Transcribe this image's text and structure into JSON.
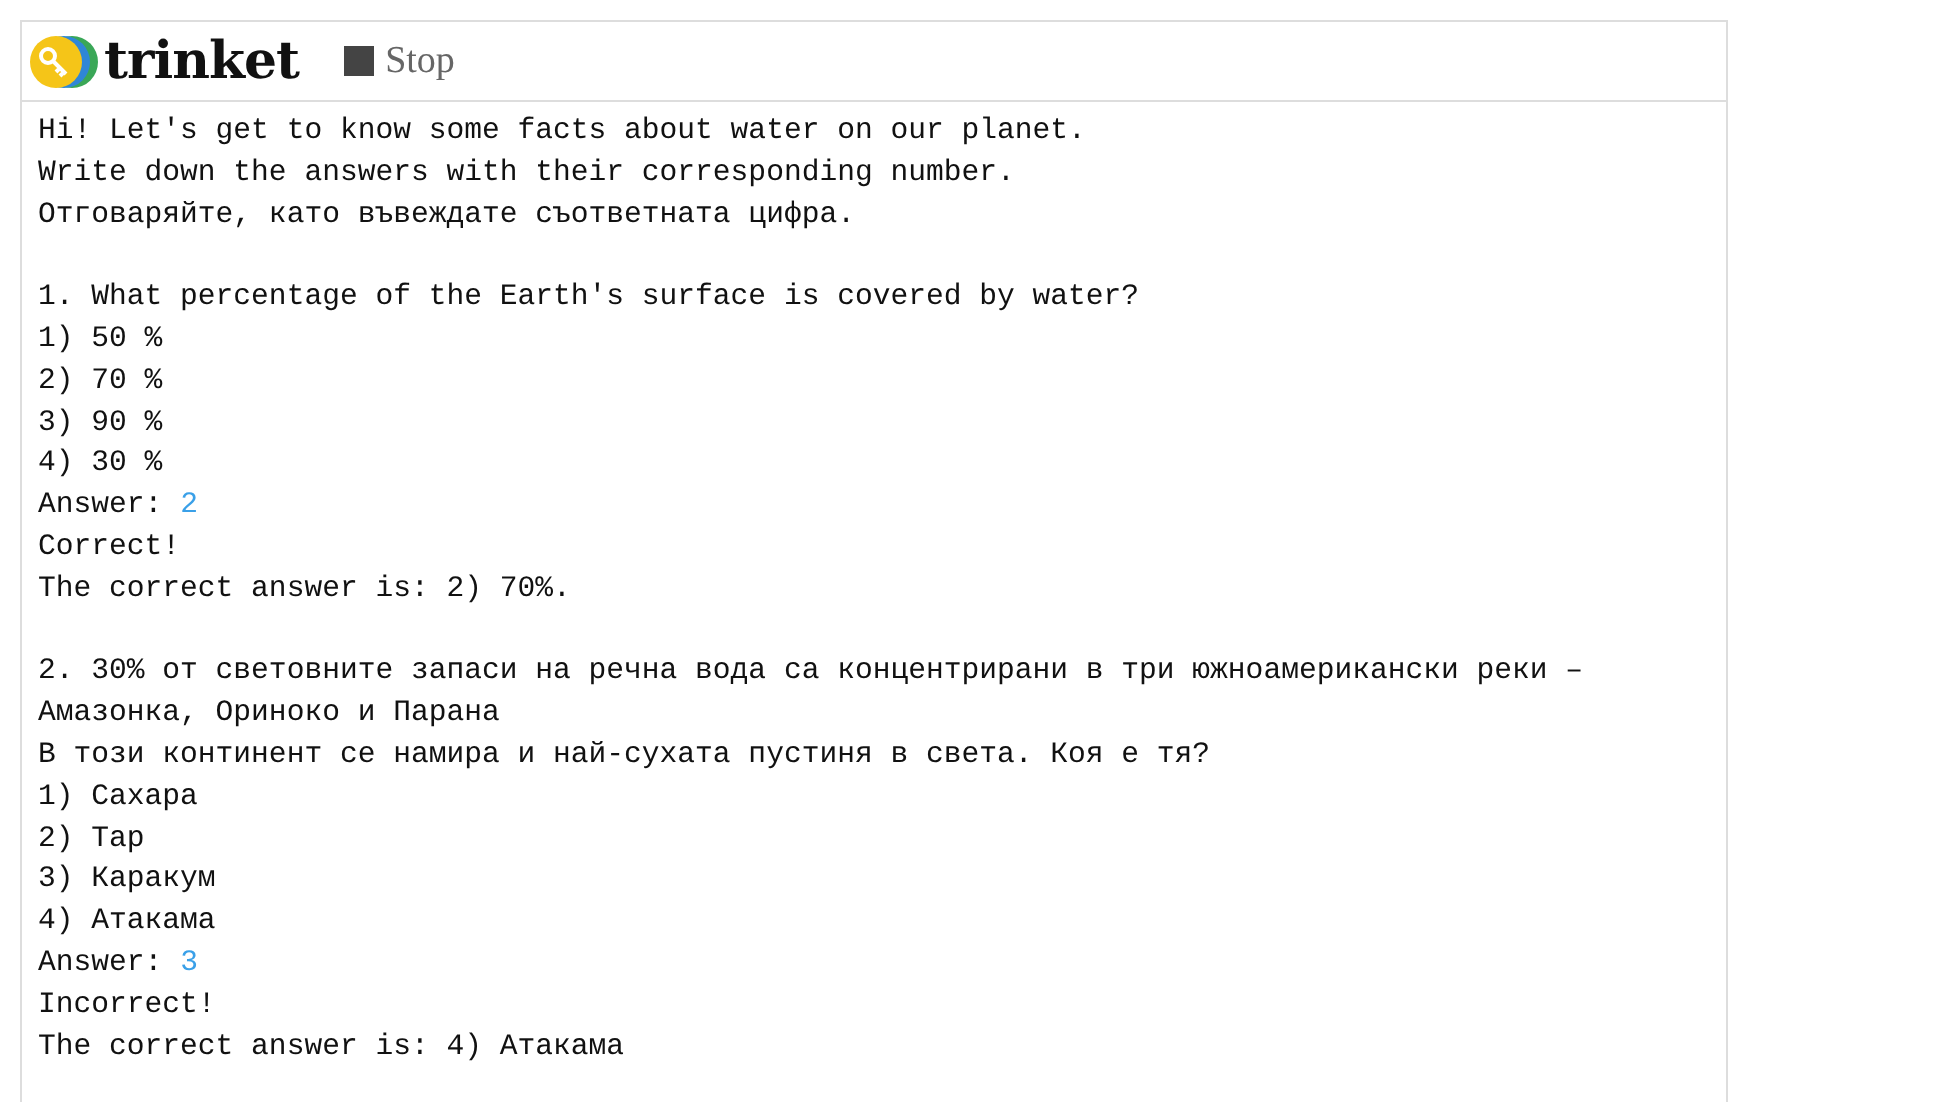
{
  "header": {
    "logo_text": "trinket",
    "stop_button": "Stop"
  },
  "console": [
    {
      "kind": "text",
      "text": "Hi! Let's get to know some facts about water on our planet."
    },
    {
      "kind": "text",
      "text": "Write down the answers with their corresponding number."
    },
    {
      "kind": "text",
      "text": "Отговаряйте, като въвеждате съответната цифра."
    },
    {
      "kind": "blank"
    },
    {
      "kind": "text",
      "text": "1. What percentage of the Earth's surface is covered by water?"
    },
    {
      "kind": "text",
      "text": "1) 50 %"
    },
    {
      "kind": "text",
      "text": "2) 70 %"
    },
    {
      "kind": "text",
      "text": "3) 90 %"
    },
    {
      "kind": "text",
      "text": "4) 30 %"
    },
    {
      "kind": "answer",
      "prompt": "Answer:",
      "value": "2"
    },
    {
      "kind": "text",
      "text": "Correct!"
    },
    {
      "kind": "text",
      "text": "The correct answer is: 2) 70%."
    },
    {
      "kind": "blank"
    },
    {
      "kind": "text",
      "text": "2. 30% от световните запаси на речна вода са концентрирани в три южноамерикански реки –"
    },
    {
      "kind": "text",
      "text": "Амазонка, Ориноко и Парана"
    },
    {
      "kind": "text",
      "text": "В този континент се намира и най-сухата пустиня в света. Коя е тя?"
    },
    {
      "kind": "text",
      "text": "1) Сахара"
    },
    {
      "kind": "text",
      "text": "2) Тар"
    },
    {
      "kind": "text",
      "text": "3) Каракум"
    },
    {
      "kind": "text",
      "text": "4) Атакама"
    },
    {
      "kind": "answer",
      "prompt": "Answer:",
      "value": "3"
    },
    {
      "kind": "text",
      "text": "Incorrect!"
    },
    {
      "kind": "text",
      "text": "The correct answer is: 4) Атакама"
    }
  ]
}
